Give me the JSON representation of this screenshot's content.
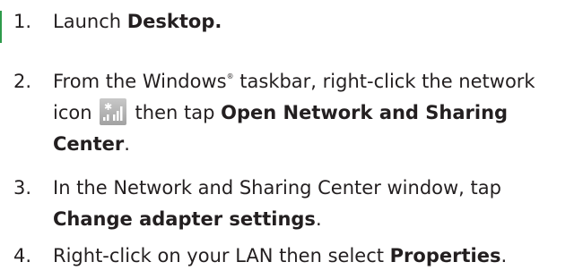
{
  "steps": [
    {
      "number": "1.",
      "parts": {
        "text1": "Launch ",
        "bold1": "Desktop."
      }
    },
    {
      "number": "2.",
      "parts": {
        "text1": "From the Windows",
        "reg": "®",
        "text2": " taskbar, right-click the network",
        "text3": "icon",
        "icon": "network-icon",
        "text4": "then tap ",
        "bold1": "Open Network and Sharing",
        "bold2": "Center",
        "text5": "."
      }
    },
    {
      "number": "3.",
      "parts": {
        "text1": "In the Network and Sharing Center window, tap",
        "bold1": "Change adapter settings",
        "text2": "."
      }
    },
    {
      "number": "4.",
      "parts": {
        "text1": "Right-click on your LAN then select ",
        "bold1": "Properties",
        "text2": "."
      }
    }
  ],
  "colors": {
    "text": "#231f20",
    "accent": "#2e9a4a"
  }
}
